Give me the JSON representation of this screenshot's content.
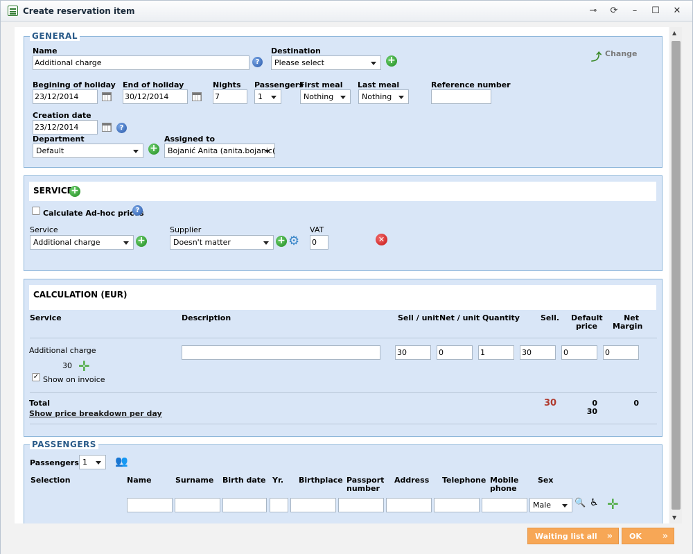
{
  "window": {
    "title": "Create reservation item",
    "buttons": [
      "pin",
      "refresh",
      "minimize",
      "maximize",
      "close"
    ]
  },
  "general": {
    "legend": "GENERAL",
    "name_label": "Name",
    "name_value": "Additional charge",
    "destination_label": "Destination",
    "destination_value": "Please select",
    "change_label": "Change",
    "begin_label": "Begining of holiday",
    "begin_value": "23/12/2014",
    "end_label": "End of holiday",
    "end_value": "30/12/2014",
    "nights_label": "Nights",
    "nights_value": "7",
    "passengers_label": "Passengers",
    "passengers_value": "1",
    "first_meal_label": "First meal",
    "first_meal_value": "Nothing",
    "last_meal_label": "Last meal",
    "last_meal_value": "Nothing",
    "reference_label": "Reference number",
    "reference_value": "",
    "creation_label": "Creation date",
    "creation_value": "23/12/2014",
    "department_label": "Department",
    "department_value": "Default",
    "assigned_label": "Assigned to",
    "assigned_value": "Bojanić Anita (anita.bojanic(("
  },
  "services": {
    "title": "SERVICES",
    "adhoc_label": "Calculate Ad-hoc prices",
    "adhoc_checked": false,
    "service_label": "Service",
    "service_value": "Additional charge",
    "supplier_label": "Supplier",
    "supplier_value": "Doesn't matter",
    "vat_label": "VAT",
    "vat_value": "0"
  },
  "calculation": {
    "title": "CALCULATION (EUR)",
    "headers": {
      "service": "Service",
      "description": "Description",
      "sell_unit": "Sell / unit",
      "net_unit": "Net / unit",
      "quantity": "Quantity",
      "sell": "Sell.",
      "default_price_1": "Default",
      "default_price_2": "price",
      "net_margin_1": "Net",
      "net_margin_2": "Margin"
    },
    "row": {
      "service": "Additional charge",
      "amount": "30",
      "description": "",
      "sell_unit": "30",
      "net_unit": "0",
      "quantity": "1",
      "sell": "30",
      "default_price": "0",
      "net_margin": "0",
      "show_on_invoice_label": "Show on invoice",
      "show_on_invoice": true
    },
    "total_label": "Total",
    "total_sell": "30",
    "total_default_1": "0",
    "total_default_2": "30",
    "total_margin": "0",
    "breakdown_link": "Show price breakdown per day"
  },
  "passengers": {
    "legend": "PASSENGERS",
    "count_label": "Passengers",
    "count_value": "1",
    "headers": {
      "selection": "Selection",
      "name": "Name",
      "surname": "Surname",
      "birth_date": "Birth date",
      "yr": "Yr.",
      "birthplace": "Birthplace",
      "passport_1": "Passport",
      "passport_2": "number",
      "address": "Address",
      "telephone": "Telephone",
      "mobile_1": "Mobile",
      "mobile_2": "phone",
      "sex": "Sex"
    },
    "sex_value": "Male"
  },
  "footer": {
    "waiting_label": "Waiting list all",
    "ok_label": "OK"
  }
}
